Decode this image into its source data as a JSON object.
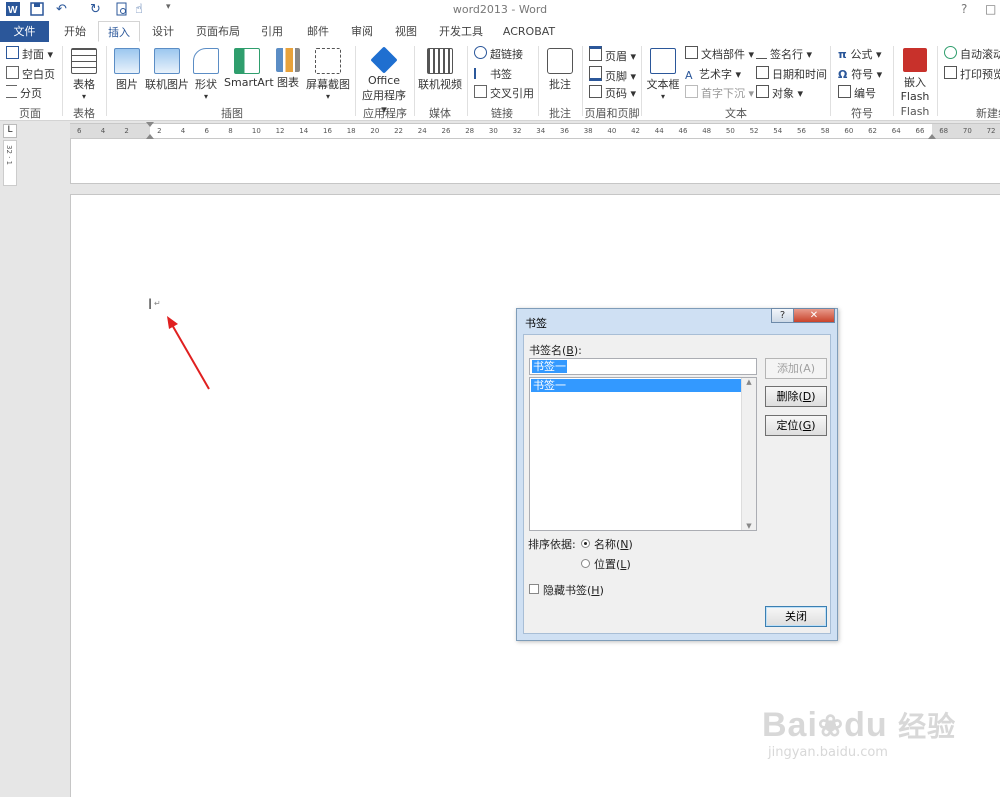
{
  "window": {
    "title": "word2013 - Word",
    "help": "?",
    "restore": "□"
  },
  "tabs": [
    "文件",
    "开始",
    "插入",
    "设计",
    "页面布局",
    "引用",
    "邮件",
    "审阅",
    "视图",
    "开发工具",
    "ACROBAT"
  ],
  "ribbon": {
    "pages": {
      "cover": "封面",
      "blank": "空白页",
      "break": "分页",
      "group": "页面"
    },
    "table": {
      "label": "表格",
      "group": "表格"
    },
    "illustrations": {
      "picture": "图片",
      "online_picture": "联机图片",
      "shapes": "形状",
      "smartart": "SmartArt",
      "chart": "图表",
      "screenshot": "屏幕截图",
      "group": "插图"
    },
    "apps": {
      "line1": "Office",
      "line2": "应用程序",
      "group": "应用程序"
    },
    "media": {
      "online_video": "联机视频",
      "group": "媒体"
    },
    "links": {
      "hyperlink": "超链接",
      "bookmark": "书签",
      "cross_ref": "交叉引用",
      "group": "链接"
    },
    "comments": {
      "comment": "批注",
      "group": "批注"
    },
    "header_footer": {
      "header": "页眉",
      "footer": "页脚",
      "page_number": "页码",
      "group": "页眉和页脚"
    },
    "text": {
      "textbox": "文本框",
      "quick_parts": "文档部件",
      "wordart": "艺术字",
      "dropcap": "首字下沉",
      "signature": "签名行",
      "datetime": "日期和时间",
      "object": "对象",
      "group": "文本"
    },
    "symbols": {
      "equation": "公式",
      "symbol": "符号",
      "number": "编号",
      "group": "符号"
    },
    "flash": {
      "line1": "嵌入",
      "line2": "Flash",
      "group": "Flash"
    },
    "new": {
      "autoscroll": "自动滚动",
      "print_preview": "打印预览",
      "group": "新建组"
    }
  },
  "ruler": {
    "numbers": [
      "6",
      "4",
      "2",
      "2",
      "4",
      "6",
      "8",
      "10",
      "12",
      "14",
      "16",
      "18",
      "20",
      "22",
      "24",
      "26",
      "28",
      "30",
      "32",
      "34",
      "36",
      "38",
      "40",
      "42",
      "44",
      "46",
      "48",
      "50",
      "52",
      "54",
      "56",
      "58",
      "60",
      "62",
      "64",
      "66",
      "68",
      "70",
      "72"
    ],
    "corner": "L",
    "vertical": "32 · 1"
  },
  "document": {
    "paragraph_mark": "↵"
  },
  "dialog": {
    "title": "书签",
    "name_label": "书签名(",
    "name_key": "B",
    "name_label_end": "):",
    "name_value": "书签一",
    "list_items": [
      "书签一"
    ],
    "add_button": "添加(A)",
    "delete_button": "删除(",
    "delete_key": "D",
    "goto_button": "定位(",
    "goto_key": "G",
    "sort_label": "排序依据:",
    "sort_name": "名称(",
    "sort_name_key": "N",
    "sort_location": "位置(",
    "sort_location_key": "L",
    "hide_label": "隐藏书签(",
    "hide_key": "H",
    "close_button": "关闭",
    "help_btn": "?",
    "close_x": "✕"
  },
  "watermark": {
    "brand": "Bai",
    "brand2": "du",
    "cn": "经验",
    "url": "jingyan.baidu.com"
  },
  "colors": {
    "accent": "#2b579a",
    "selection": "#3399ff",
    "arrow": "#e02020"
  }
}
